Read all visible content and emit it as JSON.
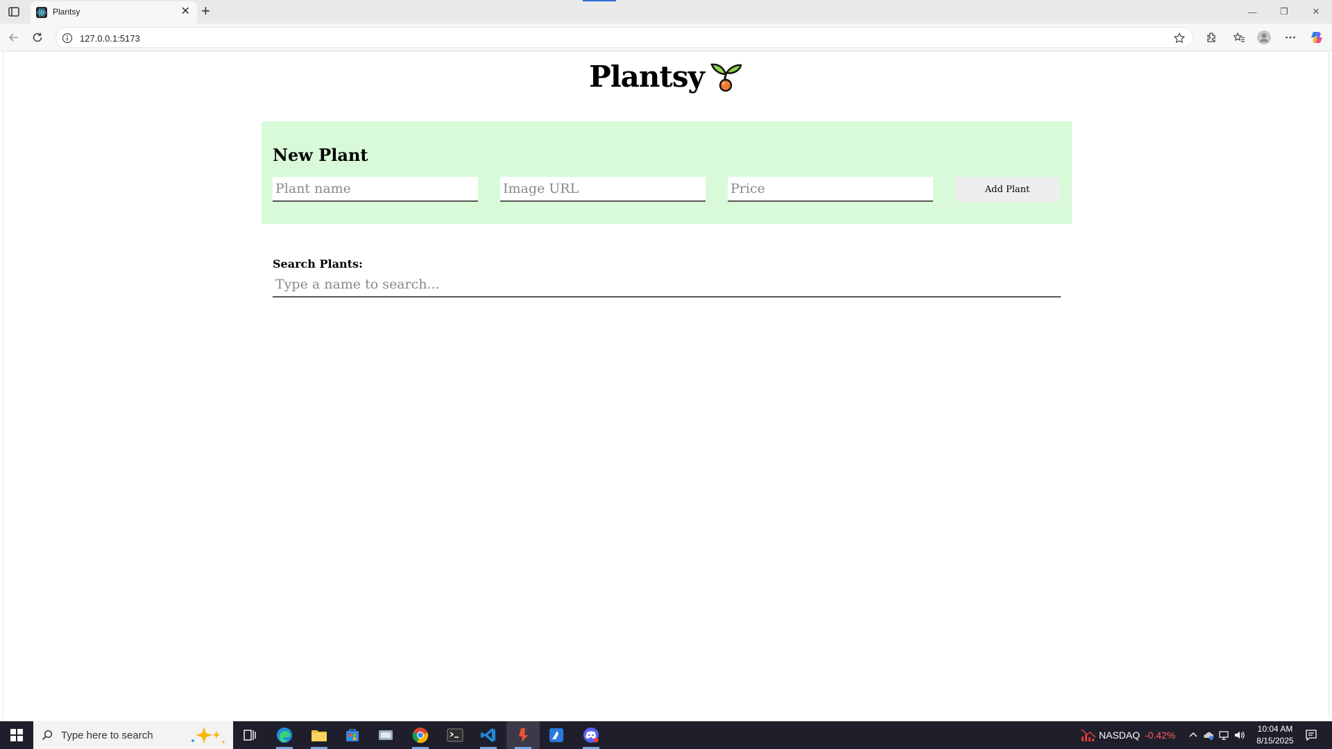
{
  "browser": {
    "tab_title": "Plantsy",
    "url": "127.0.0.1:5173"
  },
  "page": {
    "site_title": "Plantsy",
    "new_plant": {
      "title": "New Plant",
      "name_placeholder": "Plant name",
      "image_placeholder": "Image URL",
      "price_placeholder": "Price",
      "submit_label": "Add Plant"
    },
    "search": {
      "label": "Search Plants:",
      "placeholder": "Type a name to search..."
    }
  },
  "taskbar": {
    "search_placeholder": "Type here to search",
    "stock_name": "NASDAQ",
    "stock_change": "-0.42%",
    "time": "10:04 AM",
    "date": "8/15/2025",
    "apps": [
      "task-view",
      "edge",
      "file-explorer",
      "store",
      "app-generic",
      "chrome",
      "terminal",
      "vscode",
      "git-app",
      "app-blue",
      "discord-app"
    ]
  },
  "colors": {
    "panel_bg": "#d9fad9",
    "taskbar_bg": "#1f1f2b",
    "stock_down": "#ff5a5a"
  }
}
